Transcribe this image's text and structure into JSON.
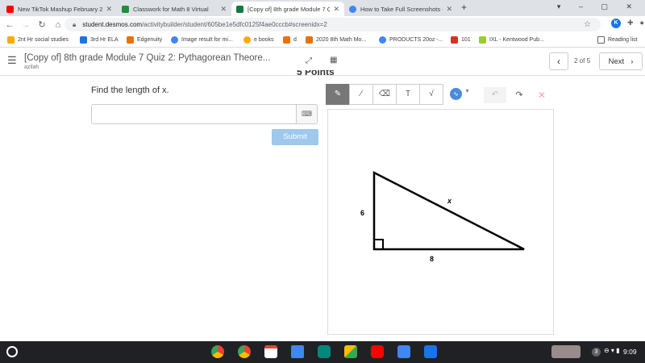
{
  "browser": {
    "tabs": [
      {
        "title": "New TikTok Mashup February 2",
        "favicon": "youtube-icon",
        "color": "#ff0000"
      },
      {
        "title": "Classwork for Math 8 Virtual",
        "favicon": "google-classroom-icon",
        "color": "#1e8e3e"
      },
      {
        "title": "[Copy of] 8th grade Module 7 Qu",
        "favicon": "desmos-icon",
        "color": "#127a3f"
      },
      {
        "title": "How to Take Full Screenshots -",
        "favicon": "google-icon",
        "color": "#4285f4"
      }
    ],
    "url_domain": "student.desmos.com",
    "url_path": "/activitybuilder/student/605be1e5dfc0125f4ae0cccb#screenidx=2",
    "bookmarks": [
      {
        "label": "2nt Hr social studies",
        "color": "#f9ab00"
      },
      {
        "label": "3rd Hr ELA",
        "color": "#1a73e8"
      },
      {
        "label": "Edgenuity",
        "color": "#e8710a"
      },
      {
        "label": "Image result for mi...",
        "color": "#4285f4"
      },
      {
        "label": "e books",
        "color": "#f9ab00"
      },
      {
        "label": "d",
        "color": "#e8710a"
      },
      {
        "label": "2020 8th Math Mo...",
        "color": "#e8710a"
      },
      {
        "label": "PRODUCTS 20oz -...",
        "color": "#4285f4"
      },
      {
        "label": "101",
        "color": "#d93025"
      },
      {
        "label": "IXL - Kentwood Pub...",
        "color": "#9acd32"
      }
    ],
    "reading_list": "Reading list"
  },
  "app": {
    "title": "[Copy of] 8th grade Module 7 Quiz 2: Pythagorean Theore...",
    "student": "azilah",
    "page_counter": "2 of 5",
    "next_label": "Next",
    "cutoff_text": "5 Points"
  },
  "question": {
    "prompt": "Find the length of x.",
    "submit_label": "Submit"
  },
  "figure": {
    "leg_vertical": "6",
    "leg_horizontal": "8",
    "hypotenuse": "x"
  },
  "system": {
    "time": "9:09",
    "notification_count": "3"
  },
  "colors": {
    "accent": "#4a8ad8",
    "submit_disabled": "#9ec8ec"
  }
}
